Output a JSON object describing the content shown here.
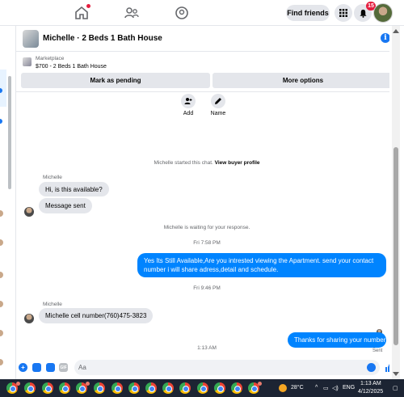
{
  "top_nav": {
    "find_friends_label": "Find friends",
    "notification_count": "15"
  },
  "chat": {
    "title": "Michelle · 2 Beds 1 Bath House",
    "listing": {
      "category": "Marketplace",
      "price_title": "$700 - 2 Beds 1 Bath House"
    },
    "mark_pending_label": "Mark as pending",
    "more_options_label": "More options",
    "shortcuts": [
      {
        "label": "Add",
        "icon": "add-user-icon"
      },
      {
        "label": "Name",
        "icon": "pencil-icon"
      }
    ],
    "started_text": "Michelle started this chat.",
    "view_profile_label": "View buyer profile",
    "sender_name_1": "Michelle",
    "msg_in_1": "Hi, is this available?",
    "msg_in_2": "Message sent",
    "waiting_text": "Michelle is waiting for your response.",
    "time_1": "Fri 7:58 PM",
    "msg_out_1": "Yes Its Still Available,Are you intrested viewing the Apartment. send your contact number i will share adress,detail and schedule.",
    "time_2": "Fri 9:46 PM",
    "sender_name_2": "Michelle",
    "msg_in_3": "Michelle cell number(760)475-3823",
    "time_3": "1:13 AM",
    "msg_out_2": "Thanks for sharing your number",
    "sent_label": "Sent",
    "compose_placeholder": "Aa"
  },
  "taskbar": {
    "temperature": "28°C",
    "language": "ENG",
    "time": "1:13 AM",
    "date": "4/12/2025"
  },
  "colors": {
    "accent": "#1877f2",
    "outgoing_bubble": "#0084ff",
    "incoming_bubble": "#e4e6eb",
    "notification_red": "#e41e3f",
    "taskbar": "#1c2433"
  }
}
